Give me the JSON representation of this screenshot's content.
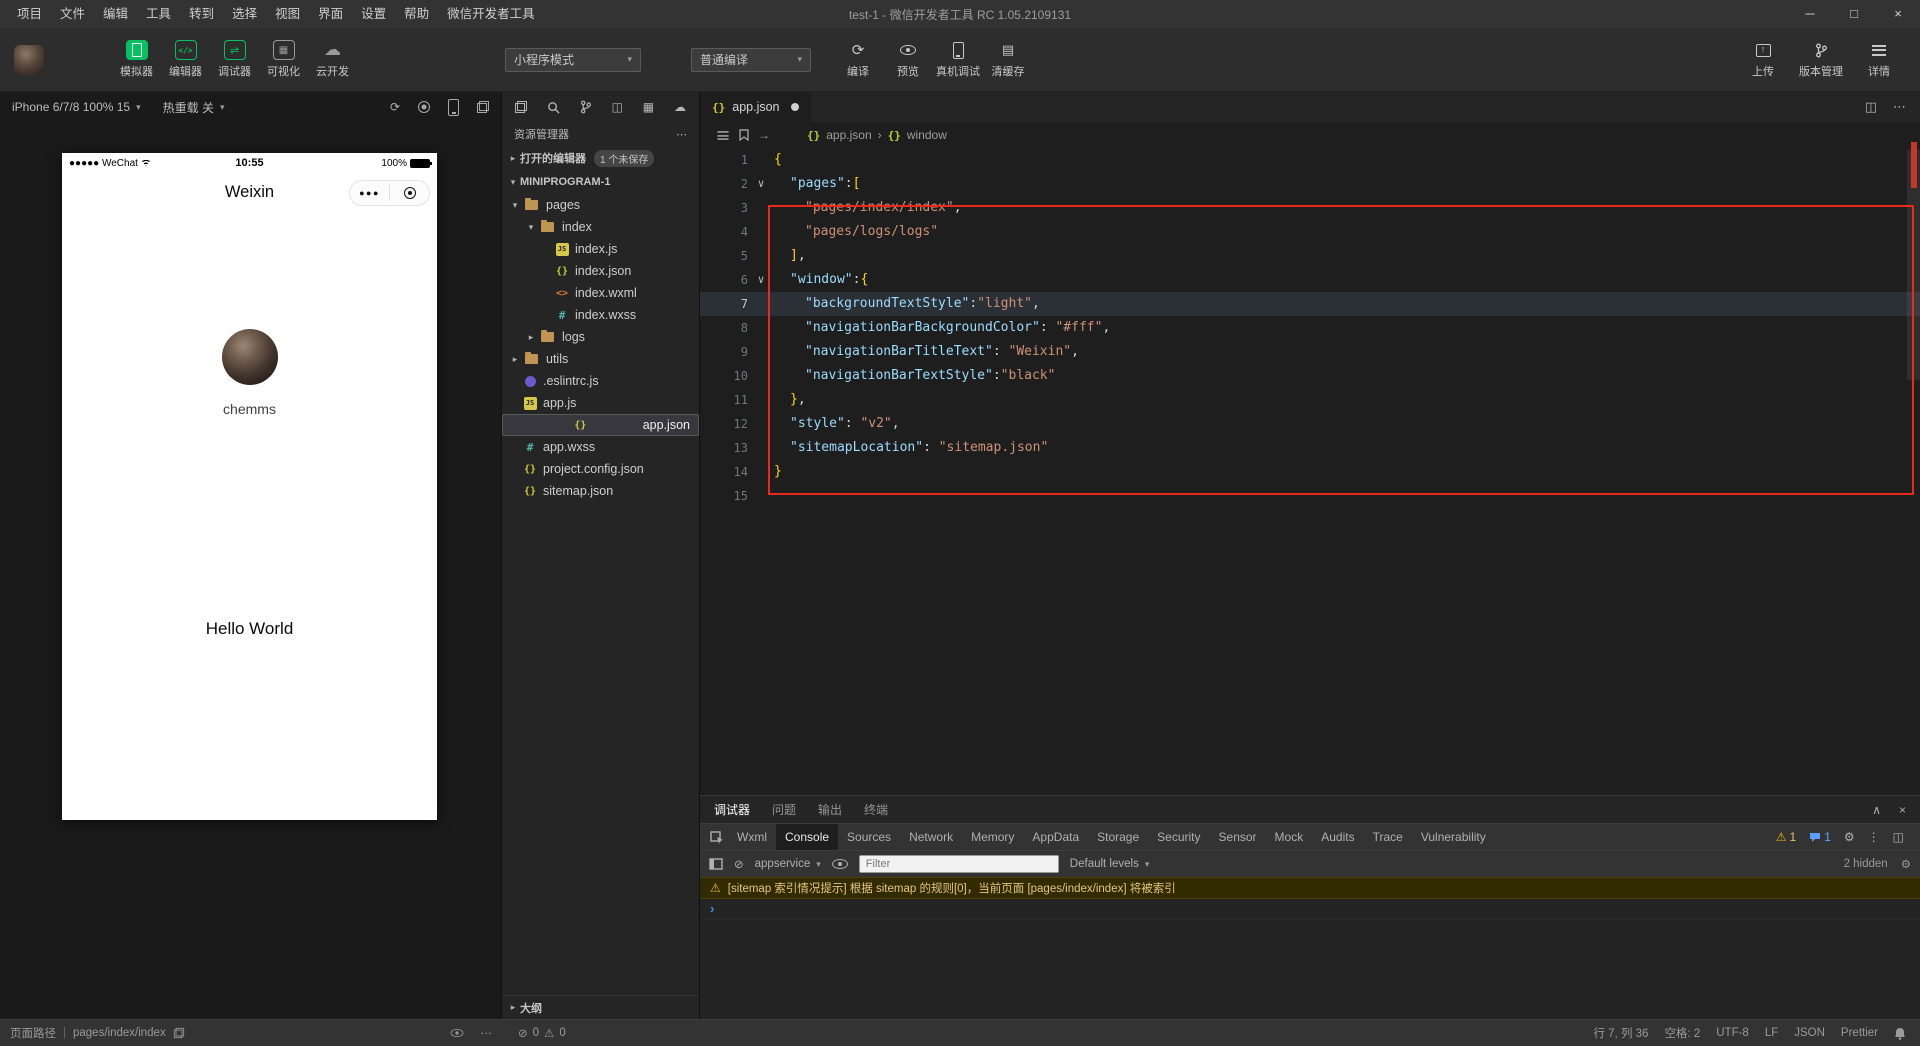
{
  "title_bar": {
    "menus": [
      "项目",
      "文件",
      "编辑",
      "工具",
      "转到",
      "选择",
      "视图",
      "界面",
      "设置",
      "帮助",
      "微信开发者工具"
    ],
    "title": "test-1 - 微信开发者工具 RC 1.05.2109131"
  },
  "toolbar": {
    "toggles": [
      {
        "label": "模拟器"
      },
      {
        "label": "编辑器"
      },
      {
        "label": "调试器"
      },
      {
        "label": "可视化"
      },
      {
        "label": "云开发"
      }
    ],
    "mode_select": "小程序模式",
    "compile_select": "普通编译",
    "actions": [
      {
        "label": "编译"
      },
      {
        "label": "预览"
      },
      {
        "label": "真机调试"
      },
      {
        "label": "清缓存"
      }
    ],
    "right_actions": [
      {
        "label": "上传"
      },
      {
        "label": "版本管理"
      },
      {
        "label": "详情"
      }
    ]
  },
  "simulator": {
    "device_select": "iPhone 6/7/8 100% 15",
    "hot_reload_select": "热重载 关",
    "phone": {
      "carrier": "●●●●● WeChat",
      "time": "10:55",
      "battery_percent": "100%",
      "nav_title": "Weixin",
      "capsule_dots": "●●●",
      "username": "chemms",
      "body_text": "Hello World"
    }
  },
  "explorer": {
    "header": "资源管理器",
    "open_editors_label": "打开的编辑器",
    "unsaved_badge": "1 个未保存",
    "root_label": "MINIPROGRAM-1",
    "tree": [
      {
        "label": "pages"
      },
      {
        "label": "index"
      },
      {
        "label": "index.js"
      },
      {
        "label": "index.json"
      },
      {
        "label": "index.wxml"
      },
      {
        "label": "index.wxss"
      },
      {
        "label": "logs"
      },
      {
        "label": "utils"
      },
      {
        "label": ".eslintrc.js"
      },
      {
        "label": "app.js"
      },
      {
        "label": "app.json"
      },
      {
        "label": "app.wxss"
      },
      {
        "label": "project.config.json"
      },
      {
        "label": "sitemap.json"
      }
    ],
    "outline_label": "大纲"
  },
  "editor": {
    "tab_label": "app.json",
    "breadcrumb": {
      "file": "app.json",
      "node": "window"
    },
    "lines": [
      {
        "num": "1",
        "segs": [
          {
            "t": "{",
            "c": "b"
          }
        ]
      },
      {
        "num": "2",
        "segs": [
          {
            "t": "\"pages\"",
            "c": "k"
          },
          {
            "t": ":",
            "c": "p"
          },
          {
            "t": "[",
            "c": "b"
          }
        ]
      },
      {
        "num": "3",
        "segs": [
          {
            "t": "\"pages/index/index\"",
            "c": "s"
          },
          {
            "t": ",",
            "c": "p"
          }
        ]
      },
      {
        "num": "4",
        "segs": [
          {
            "t": "\"pages/logs/logs\"",
            "c": "s"
          }
        ]
      },
      {
        "num": "5",
        "segs": [
          {
            "t": "]",
            "c": "b"
          },
          {
            "t": ",",
            "c": "p"
          }
        ]
      },
      {
        "num": "6",
        "segs": [
          {
            "t": "\"window\"",
            "c": "k"
          },
          {
            "t": ":",
            "c": "p"
          },
          {
            "t": "{",
            "c": "b"
          }
        ]
      },
      {
        "num": "7",
        "segs": [
          {
            "t": "\"backgroundTextStyle\"",
            "c": "k"
          },
          {
            "t": ":",
            "c": "p"
          },
          {
            "t": "\"light\"",
            "c": "s"
          },
          {
            "t": ",",
            "c": "p"
          }
        ]
      },
      {
        "num": "8",
        "segs": [
          {
            "t": "\"navigationBarBackgroundColor\"",
            "c": "k"
          },
          {
            "t": ": ",
            "c": "p"
          },
          {
            "t": "\"#fff\"",
            "c": "s"
          },
          {
            "t": ",",
            "c": "p"
          }
        ]
      },
      {
        "num": "9",
        "segs": [
          {
            "t": "\"navigationBarTitleText\"",
            "c": "k"
          },
          {
            "t": ": ",
            "c": "p"
          },
          {
            "t": "\"Weixin\"",
            "c": "s"
          },
          {
            "t": ",",
            "c": "p"
          }
        ]
      },
      {
        "num": "10",
        "segs": [
          {
            "t": "\"navigationBarTextStyle\"",
            "c": "k"
          },
          {
            "t": ":",
            "c": "p"
          },
          {
            "t": "\"black\"",
            "c": "s"
          }
        ]
      },
      {
        "num": "11",
        "segs": [
          {
            "t": "}",
            "c": "b"
          },
          {
            "t": ",",
            "c": "p"
          }
        ]
      },
      {
        "num": "12",
        "segs": [
          {
            "t": "\"style\"",
            "c": "k"
          },
          {
            "t": ": ",
            "c": "p"
          },
          {
            "t": "\"v2\"",
            "c": "s"
          },
          {
            "t": ",",
            "c": "p"
          }
        ]
      },
      {
        "num": "13",
        "segs": [
          {
            "t": "\"sitemapLocation\"",
            "c": "k"
          },
          {
            "t": ": ",
            "c": "p"
          },
          {
            "t": "\"sitemap.json\"",
            "c": "s"
          }
        ]
      },
      {
        "num": "14",
        "segs": [
          {
            "t": "}",
            "c": "b"
          }
        ]
      },
      {
        "num": "15",
        "segs": []
      }
    ]
  },
  "debug": {
    "panel_tabs": [
      "调试器",
      "问题",
      "输出",
      "终端"
    ],
    "devtools_tabs": [
      "Wxml",
      "Console",
      "Sources",
      "Network",
      "Memory",
      "AppData",
      "Storage",
      "Security",
      "Sensor",
      "Mock",
      "Audits",
      "Trace",
      "Vulnerability"
    ],
    "active_devtools_tab": "Console",
    "warn_count": "1",
    "info_count": "1",
    "context_select": "appservice",
    "filter_placeholder": "Filter",
    "levels_select": "Default levels",
    "hidden_label": "2 hidden",
    "warning_message": "[sitemap 索引情况提示] 根据 sitemap 的规则[0]，当前页面 [pages/index/index] 将被索引",
    "prompt": "›"
  },
  "status_bar": {
    "page_path_label": "页面路径",
    "page_path": "pages/index/index",
    "errors": "0",
    "warnings": "0",
    "cursor": "行 7, 列 36",
    "spaces": "空格: 2",
    "encoding": "UTF-8",
    "eol": "LF",
    "language": "JSON",
    "formatter": "Prettier"
  },
  "colors": {
    "wechat_green": "#07c160",
    "annotation_red": "#e8291c",
    "editor_key": "#9cdcfe",
    "editor_string": "#ce9178",
    "warning_yellow": "#f1c232"
  }
}
